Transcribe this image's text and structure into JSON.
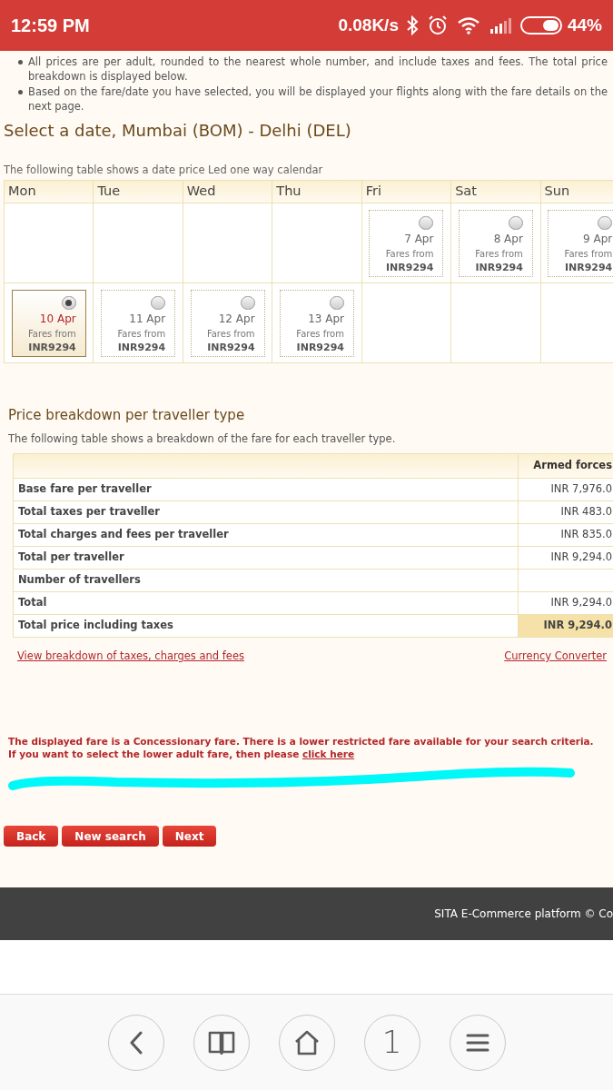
{
  "status_bar": {
    "time": "12:59 PM",
    "network_speed": "0.08K/s",
    "battery": "44%"
  },
  "notes": [
    "All prices are per adult, rounded to the nearest whole number, and include taxes and fees. The total price breakdown is displayed below.",
    "Based on the fare/date you have selected, you will be displayed your flights along with the fare details on the next page."
  ],
  "calendar": {
    "title": "Select a date, Mumbai (BOM) - Delhi (DEL)",
    "caption": "The following table shows a date price Led one way calendar",
    "days": [
      "Mon",
      "Tue",
      "Wed",
      "Thu",
      "Fri",
      "Sat",
      "Sun"
    ],
    "weeks": [
      [
        {
          "kind": "blank"
        },
        {
          "kind": "blank"
        },
        {
          "kind": "blank"
        },
        {
          "kind": "blank"
        },
        {
          "kind": "date",
          "date": "7 Apr",
          "label": "Fares from",
          "price": "INR9294",
          "selected": false
        },
        {
          "kind": "date",
          "date": "8 Apr",
          "label": "Fares from",
          "price": "INR9294",
          "selected": false
        },
        {
          "kind": "date",
          "date": "9 Apr",
          "label": "Fares from",
          "price": "INR9294",
          "selected": false
        }
      ],
      [
        {
          "kind": "date",
          "date": "10 Apr",
          "label": "Fares from",
          "price": "INR9294",
          "selected": true
        },
        {
          "kind": "date",
          "date": "11 Apr",
          "label": "Fares from",
          "price": "INR9294",
          "selected": false
        },
        {
          "kind": "date",
          "date": "12 Apr",
          "label": "Fares from",
          "price": "INR9294",
          "selected": false
        },
        {
          "kind": "date",
          "date": "13 Apr",
          "label": "Fares from",
          "price": "INR9294",
          "selected": false
        },
        {
          "kind": "blank"
        },
        {
          "kind": "blank"
        },
        {
          "kind": "blank"
        }
      ]
    ]
  },
  "price_breakdown": {
    "title": "Price breakdown per traveller type",
    "caption": "The following table shows a breakdown of the fare for each traveller type.",
    "column_header": "Armed forces",
    "rows": [
      {
        "label": "Base fare per traveller",
        "value": "INR 7,976.0",
        "highlighted": false
      },
      {
        "label": "Total taxes per traveller",
        "value": "INR 483.0",
        "highlighted": false
      },
      {
        "label": "Total charges and fees per traveller",
        "value": "INR 835.0",
        "highlighted": false
      },
      {
        "label": "Total per traveller",
        "value": "INR 9,294.0",
        "highlighted": false
      },
      {
        "label": "Number of travellers",
        "highlighted": false
      },
      {
        "label": "Total",
        "value": "INR 9,294.0",
        "highlighted": false
      },
      {
        "label": "Total price including taxes",
        "value": "INR 9,294.0",
        "highlighted": true
      }
    ],
    "links": [
      "View breakdown of taxes, charges and fees",
      "Currency Converter"
    ]
  },
  "notice": {
    "text": "The displayed fare is a Concessionary fare. There is a lower restricted fare available for your search criteria. If you want to select the lower adult fare, then please",
    "link": "click here"
  },
  "buttons": [
    "Back",
    "New search",
    "Next"
  ],
  "footer": "SITA E-Commerce platform © Co",
  "browser_nav": [
    {
      "kind": "back"
    },
    {
      "kind": "book"
    },
    {
      "kind": "home"
    },
    {
      "kind": "tabs",
      "label": "1"
    },
    {
      "kind": "menu"
    }
  ]
}
